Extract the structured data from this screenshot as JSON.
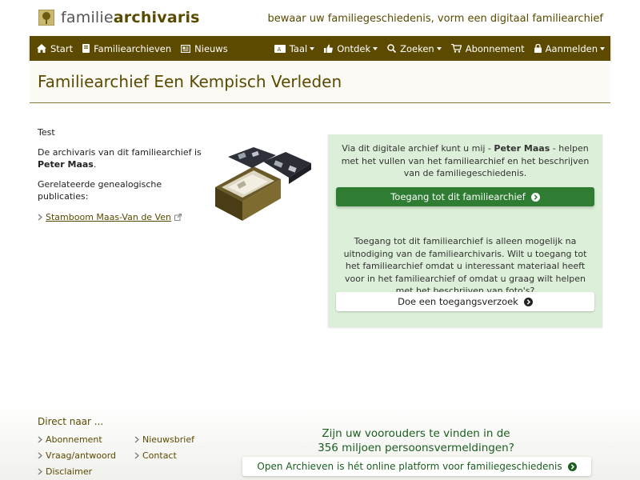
{
  "header": {
    "logo_prefix": "familie",
    "logo_bold": "archivaris",
    "tagline": "bewaar uw familiegeschiedenis, vorm een digitaal familiearchief"
  },
  "nav": {
    "start": "Start",
    "archives": "Familiearchieven",
    "news": "Nieuws",
    "language": "Taal",
    "discover": "Ontdek",
    "search": "Zoeken",
    "subscription": "Abonnement",
    "login": "Aanmelden"
  },
  "page": {
    "title": "Familiearchief Een Kempisch Verleden",
    "intro": "Test",
    "archivist_prefix": "De archivaris van dit familiearchief is",
    "archivist_name": "Peter Maas",
    "archivist_suffix": ".",
    "related_label": "Gerelateerde genealogische publicaties:",
    "publication_link": "Stamboom Maas-Van de Ven"
  },
  "card": {
    "help_prefix": "Via dit digitale archief kunt u mij -",
    "help_name": "Peter Maas",
    "help_suffix": "- helpen met het vullen van het familiearchief en het beschrijven van de familiegeschiedenis.",
    "access_button": "Toegang tot dit familiearchief",
    "request_text": "Toegang tot dit familiearchief is alleen mogelijk na uitnodiging van de familiearchivaris. Wilt u toegang tot het familiearchief omdat u interessant materiaal heeft voor in het familiearchief of omdat u graag wilt helpen met het beschrijven van foto's?",
    "request_button": "Doe een toegangsverzoek"
  },
  "footer": {
    "title": "Direct naar ...",
    "links": {
      "subscription": "Abonnement",
      "faq": "Vraag/antwoord",
      "disclaimer": "Disclaimer",
      "newsletter": "Nieuwsbrief",
      "contact": "Contact"
    },
    "promo_line1": "Zijn uw voorouders te vinden in de",
    "promo_line2": "356 miljoen persoonsvermeldingen?",
    "promo_button": "Open Archieven is hét online platform voor familiegeschiedenis"
  },
  "colors": {
    "brand": "#5c4a00",
    "green_button": "#2e7d32",
    "card_bg": "#dcefd8"
  }
}
